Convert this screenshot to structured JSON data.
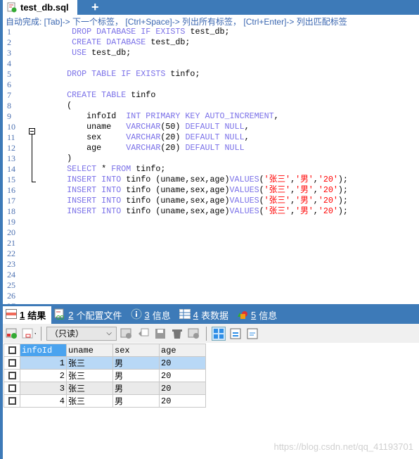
{
  "file_tab": {
    "title": "test_db.sql",
    "add_label": "+"
  },
  "hint": "自动完成: [Tab]-> 下一个标签， [Ctrl+Space]-> 列出所有标签， [Ctrl+Enter]-> 列出匹配标签",
  "editor": {
    "lines": [
      [
        {
          "t": "       DROP DATABASE IF EXISTS ",
          "c": "kw"
        },
        {
          "t": "test_db;",
          "c": "id"
        }
      ],
      [
        {
          "t": "       CREATE DATABASE ",
          "c": "kw"
        },
        {
          "t": "test_db;",
          "c": "id"
        }
      ],
      [
        {
          "t": "       USE ",
          "c": "kw"
        },
        {
          "t": "test_db;",
          "c": "id"
        }
      ],
      [],
      [
        {
          "t": "      DROP TABLE IF EXISTS ",
          "c": "kw"
        },
        {
          "t": "tinfo;",
          "c": "id"
        }
      ],
      [],
      [
        {
          "t": "      CREATE TABLE ",
          "c": "kw"
        },
        {
          "t": "tinfo",
          "c": "id"
        }
      ],
      [
        {
          "t": "      (",
          "c": "id"
        }
      ],
      [
        {
          "t": "          infoId  ",
          "c": "id"
        },
        {
          "t": "INT PRIMARY KEY AUTO_INCREMENT",
          "c": "kw"
        },
        {
          "t": ",",
          "c": "id"
        }
      ],
      [
        {
          "t": "          uname   ",
          "c": "id"
        },
        {
          "t": "VARCHAR",
          "c": "kw"
        },
        {
          "t": "(50) ",
          "c": "id"
        },
        {
          "t": "DEFAULT NULL",
          "c": "kw"
        },
        {
          "t": ",",
          "c": "id"
        }
      ],
      [
        {
          "t": "          sex     ",
          "c": "id"
        },
        {
          "t": "VARCHAR",
          "c": "kw"
        },
        {
          "t": "(20) ",
          "c": "id"
        },
        {
          "t": "DEFAULT NULL",
          "c": "kw"
        },
        {
          "t": ",",
          "c": "id"
        }
      ],
      [
        {
          "t": "          age     ",
          "c": "id"
        },
        {
          "t": "VARCHAR",
          "c": "kw"
        },
        {
          "t": "(20) ",
          "c": "id"
        },
        {
          "t": "DEFAULT NULL",
          "c": "kw"
        }
      ],
      [
        {
          "t": "      )",
          "c": "id"
        }
      ],
      [
        {
          "t": "      SELECT ",
          "c": "kw"
        },
        {
          "t": "* ",
          "c": "id"
        },
        {
          "t": "FROM ",
          "c": "kw"
        },
        {
          "t": "tinfo;",
          "c": "id"
        }
      ],
      [
        {
          "t": "      INSERT INTO ",
          "c": "kw"
        },
        {
          "t": "tinfo (uname,sex,age)",
          "c": "id"
        },
        {
          "t": "VALUES",
          "c": "kw"
        },
        {
          "t": "(",
          "c": "id"
        },
        {
          "t": "'张三'",
          "c": "str"
        },
        {
          "t": ",",
          "c": "id"
        },
        {
          "t": "'男'",
          "c": "str"
        },
        {
          "t": ",",
          "c": "id"
        },
        {
          "t": "'20'",
          "c": "str"
        },
        {
          "t": ");",
          "c": "id"
        }
      ],
      [
        {
          "t": "      INSERT INTO ",
          "c": "kw"
        },
        {
          "t": "tinfo (uname,sex,age)",
          "c": "id"
        },
        {
          "t": "VALUES",
          "c": "kw"
        },
        {
          "t": "(",
          "c": "id"
        },
        {
          "t": "'张三'",
          "c": "str"
        },
        {
          "t": ",",
          "c": "id"
        },
        {
          "t": "'男'",
          "c": "str"
        },
        {
          "t": ",",
          "c": "id"
        },
        {
          "t": "'20'",
          "c": "str"
        },
        {
          "t": ");",
          "c": "id"
        }
      ],
      [
        {
          "t": "      INSERT INTO ",
          "c": "kw"
        },
        {
          "t": "tinfo (uname,sex,age)",
          "c": "id"
        },
        {
          "t": "VALUES",
          "c": "kw"
        },
        {
          "t": "(",
          "c": "id"
        },
        {
          "t": "'张三'",
          "c": "str"
        },
        {
          "t": ",",
          "c": "id"
        },
        {
          "t": "'男'",
          "c": "str"
        },
        {
          "t": ",",
          "c": "id"
        },
        {
          "t": "'20'",
          "c": "str"
        },
        {
          "t": ");",
          "c": "id"
        }
      ],
      [
        {
          "t": "      INSERT INTO ",
          "c": "kw"
        },
        {
          "t": "tinfo (uname,sex,age)",
          "c": "id"
        },
        {
          "t": "VALUES",
          "c": "kw"
        },
        {
          "t": "(",
          "c": "id"
        },
        {
          "t": "'张三'",
          "c": "str"
        },
        {
          "t": ",",
          "c": "id"
        },
        {
          "t": "'男'",
          "c": "str"
        },
        {
          "t": ",",
          "c": "id"
        },
        {
          "t": "'20'",
          "c": "str"
        },
        {
          "t": ");",
          "c": "id"
        }
      ],
      [],
      [],
      [],
      [],
      [],
      [],
      [],
      [],
      []
    ]
  },
  "panel_tabs": [
    {
      "num": "1",
      "label": "结果",
      "icon": "result-grid-icon"
    },
    {
      "num": "2",
      "label": "个配置文件",
      "icon": "profile-icon"
    },
    {
      "num": "3",
      "label": "信息",
      "icon": "info-icon"
    },
    {
      "num": "4",
      "label": "表数据",
      "icon": "table-data-icon"
    },
    {
      "num": "5",
      "label": "信息",
      "icon": "shapes-icon"
    }
  ],
  "toolbar": {
    "mode_select": "（只读）"
  },
  "grid": {
    "columns": [
      "infoId",
      "uname",
      "sex",
      "age"
    ],
    "rows": [
      [
        "1",
        "张三",
        "男",
        "20"
      ],
      [
        "2",
        "张三",
        "男",
        "20"
      ],
      [
        "3",
        "张三",
        "男",
        "20"
      ],
      [
        "4",
        "张三",
        "男",
        "20"
      ]
    ]
  },
  "watermark": "https://blog.csdn.net/qq_41193701",
  "colors": {
    "accent": "#3d7ab8",
    "keyword": "#7a70e8",
    "string": "#ff0000",
    "selected_row": "#b8d8f6"
  }
}
